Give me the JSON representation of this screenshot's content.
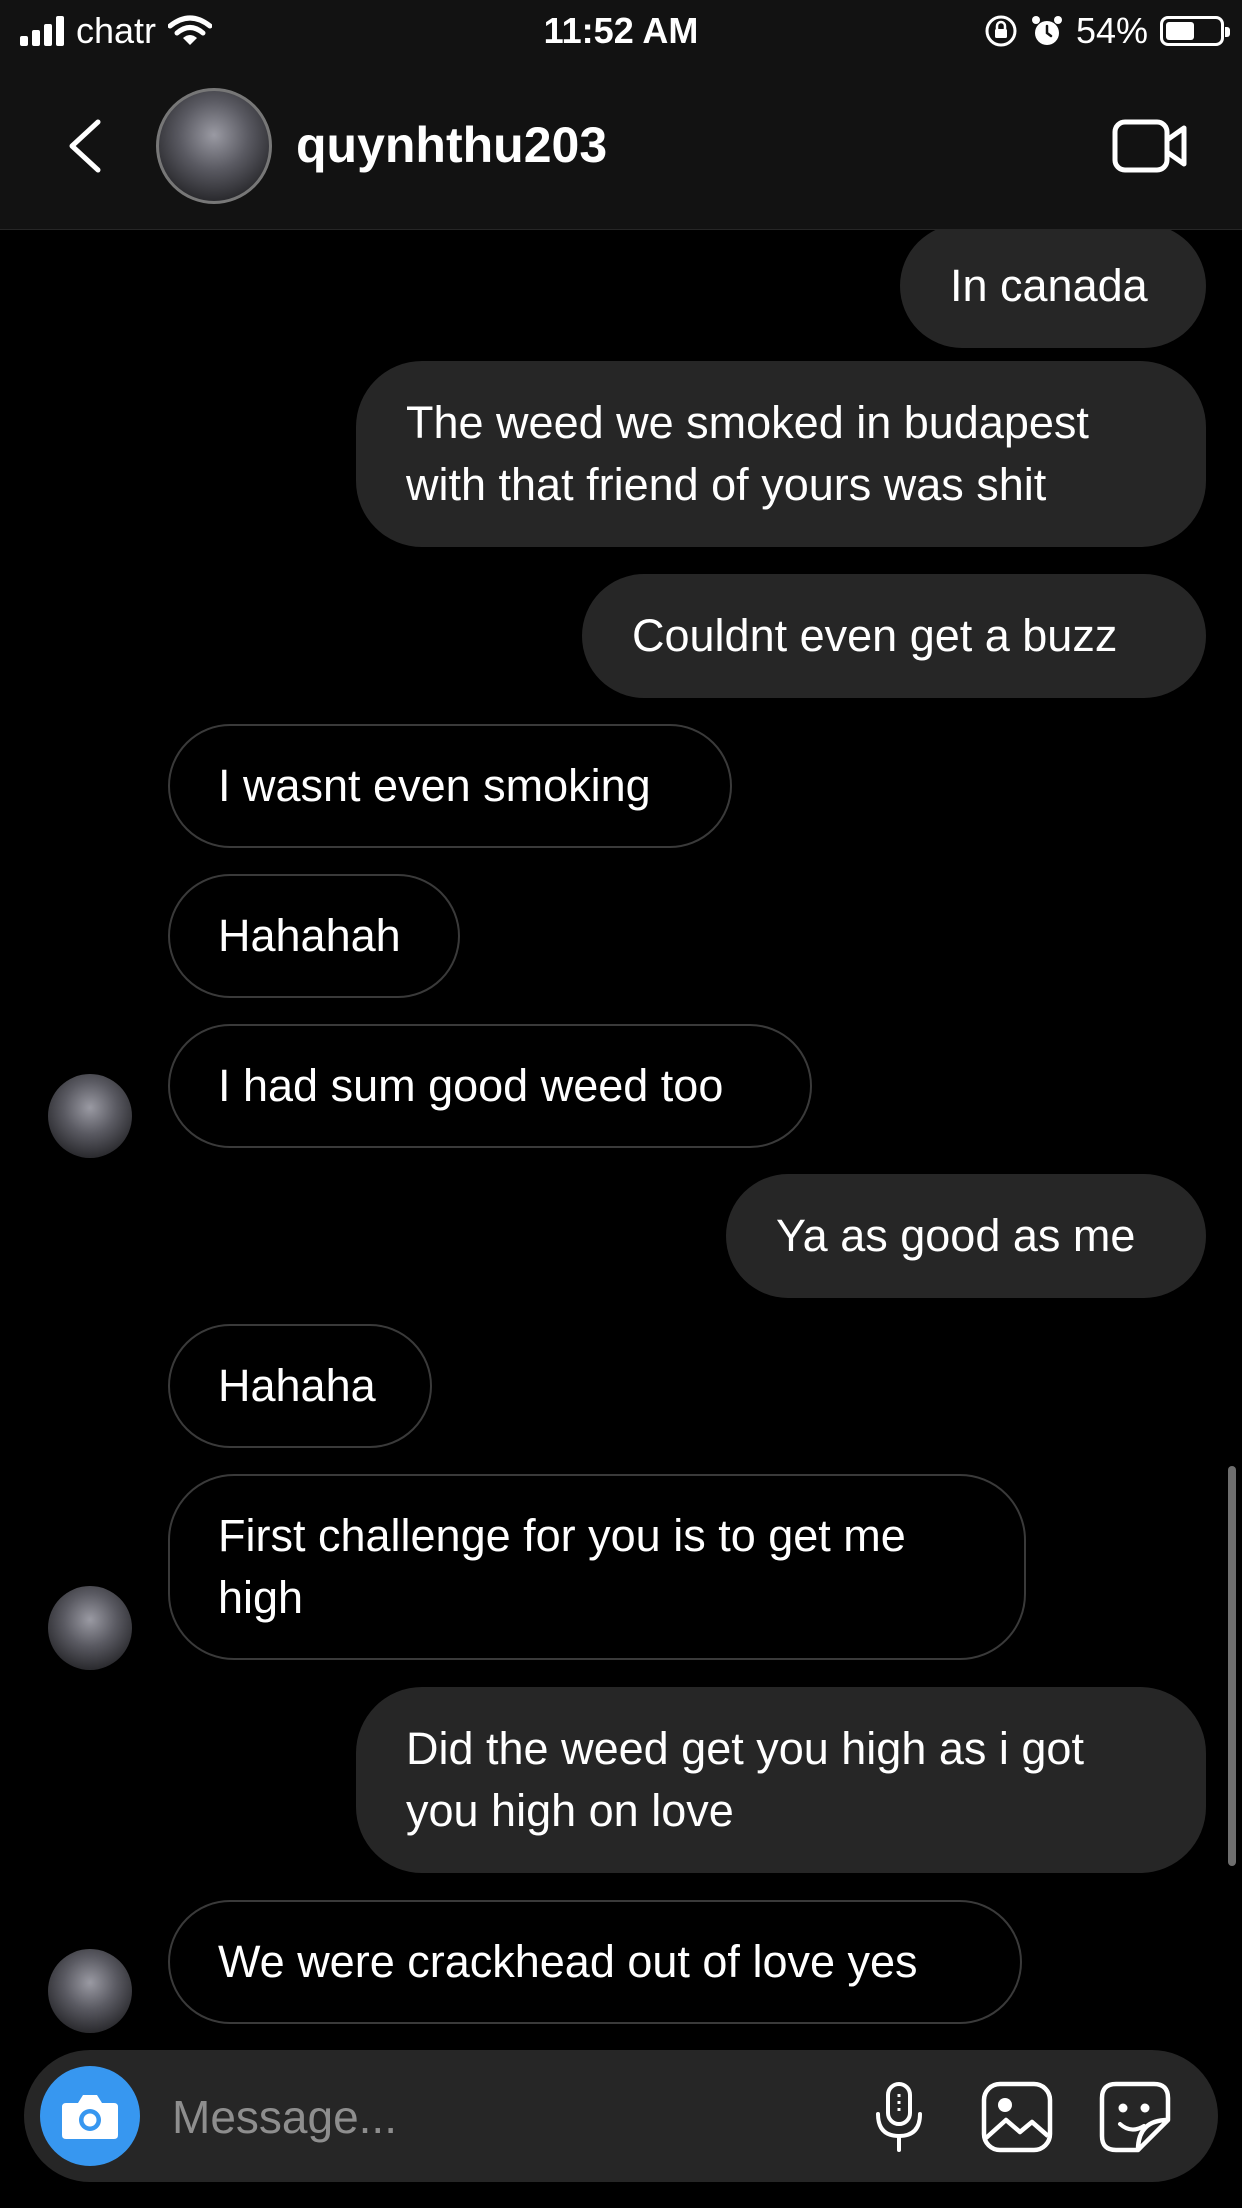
{
  "status_bar": {
    "carrier": "chatr",
    "time": "11:52 AM",
    "battery": "54%",
    "battery_level": 0.54
  },
  "header": {
    "username": "quynhthu203",
    "icons": [
      "back-icon",
      "avatar",
      "video-call-icon"
    ]
  },
  "messages": [
    {
      "sender": "me",
      "text": "In canada"
    },
    {
      "sender": "me",
      "text": "The weed we smoked in budapest with that friend of yours was shit"
    },
    {
      "sender": "me",
      "text": "Couldnt even get a buzz"
    },
    {
      "sender": "them",
      "text": "I wasnt even smoking"
    },
    {
      "sender": "them",
      "text": "Hahahah"
    },
    {
      "sender": "them",
      "text": "I had sum good weed too"
    },
    {
      "sender": "me",
      "text": "Ya as good as me"
    },
    {
      "sender": "them",
      "text": "Hahaha"
    },
    {
      "sender": "them",
      "text": "First challenge for you is to get me high"
    },
    {
      "sender": "me",
      "text": "Did the weed get you high as i got you high on love"
    },
    {
      "sender": "them",
      "text": "We were crackhead out of love yes"
    }
  ],
  "composer": {
    "placeholder": "Message...",
    "icons": [
      "camera-icon",
      "microphone-icon",
      "gallery-icon",
      "sticker-icon"
    ]
  },
  "colors": {
    "background": "#000000",
    "my_bubble": "#262626",
    "their_bubble_border": "#3a3a3a",
    "camera_button": "#3797f0",
    "placeholder": "#8e8e8e"
  }
}
